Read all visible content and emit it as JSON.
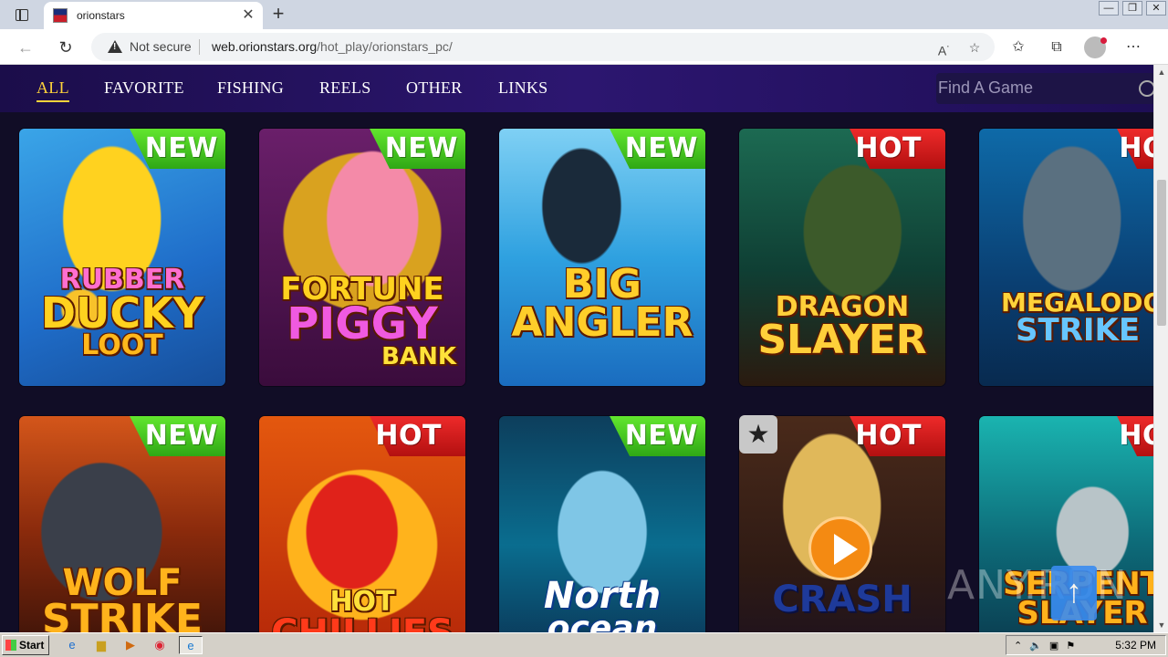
{
  "browser": {
    "tab_title": "orionstars",
    "new_tab": "+",
    "security_label": "Not secure",
    "url_host": "web.orionstars.org",
    "url_path": "/hot_play/orionstars_pc/",
    "win_min": "—",
    "win_max": "❐",
    "win_close": "✕"
  },
  "nav": {
    "categories": [
      "ALL",
      "FAVORITE",
      "FISHING",
      "REELS",
      "OTHER",
      "LINKS"
    ],
    "active": "ALL",
    "search_placeholder": "Find A Game"
  },
  "games": [
    {
      "title_lines": [
        "RUBBER",
        "DUCKY",
        "LOOT"
      ],
      "badge": "NEW"
    },
    {
      "title_lines": [
        "FORTUNE",
        "PIGGY",
        "BANK"
      ],
      "badge": "NEW"
    },
    {
      "title_lines": [
        "BIG",
        "ANGLER"
      ],
      "badge": "NEW"
    },
    {
      "title_lines": [
        "DRAGON",
        "SLAYER"
      ],
      "badge": "HOT"
    },
    {
      "title_lines": [
        "MEGALODON",
        "STRIKE"
      ],
      "badge": "HOT"
    },
    {
      "title_lines": [
        "WOLF",
        "STRIKE"
      ],
      "badge": "NEW"
    },
    {
      "title_lines": [
        "HOT",
        "CHILLIES"
      ],
      "badge": "HOT"
    },
    {
      "title_lines": [
        "North",
        "ocean"
      ],
      "badge": "NEW"
    },
    {
      "title_lines": [
        "CRASH"
      ],
      "badge": "HOT"
    },
    {
      "title_lines": [
        "SERPENT",
        "SLAYER"
      ],
      "badge": "HOT"
    }
  ],
  "watermark": "ANY.RUN",
  "taskbar": {
    "start_label": "Start",
    "clock": "5:32 PM"
  },
  "colors": {
    "nav_active": "#ffd43b",
    "badge_new": "#3fc21d",
    "badge_hot": "#d81a1a",
    "page_bg": "#110d26"
  }
}
